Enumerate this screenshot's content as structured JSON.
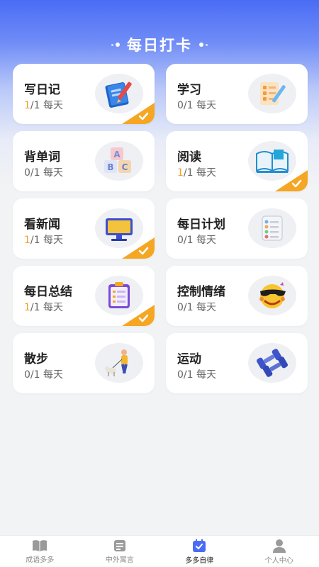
{
  "header": {
    "title": "每日打卡"
  },
  "cards": [
    {
      "name": "写日记",
      "done": "1",
      "rest": "/1 每天",
      "checked": true,
      "icon": "notebook-pen-icon"
    },
    {
      "name": "学习",
      "done": "",
      "rest": "0/1 每天",
      "checked": false,
      "icon": "checklist-pen-icon"
    },
    {
      "name": "背单词",
      "done": "",
      "rest": "0/1 每天",
      "checked": false,
      "icon": "abc-blocks-icon"
    },
    {
      "name": "阅读",
      "done": "1",
      "rest": "/1 每天",
      "checked": true,
      "icon": "open-book-icon"
    },
    {
      "name": "看新闻",
      "done": "1",
      "rest": "/1 每天",
      "checked": true,
      "icon": "monitor-icon"
    },
    {
      "name": "每日计划",
      "done": "",
      "rest": "0/1 每天",
      "checked": false,
      "icon": "plan-list-icon"
    },
    {
      "name": "每日总结",
      "done": "1",
      "rest": "/1 每天",
      "checked": true,
      "icon": "clipboard-icon"
    },
    {
      "name": "控制情绪",
      "done": "",
      "rest": "0/1 每天",
      "checked": false,
      "icon": "cool-emoji-icon"
    },
    {
      "name": "散步",
      "done": "",
      "rest": "0/1 每天",
      "checked": false,
      "icon": "walking-dog-icon"
    },
    {
      "name": "运动",
      "done": "",
      "rest": "0/1 每天",
      "checked": false,
      "icon": "dumbbell-icon"
    }
  ],
  "tabs": [
    {
      "label": "成语多多",
      "icon": "book-icon",
      "active": false
    },
    {
      "label": "中外寓言",
      "icon": "document-icon",
      "active": false
    },
    {
      "label": "多多自律",
      "icon": "calendar-check-icon",
      "active": true
    },
    {
      "label": "个人中心",
      "icon": "person-icon",
      "active": false
    }
  ],
  "colors": {
    "accent": "#4a6cf5",
    "done_orange": "#f2a329",
    "check_orange": "#f5a623"
  }
}
